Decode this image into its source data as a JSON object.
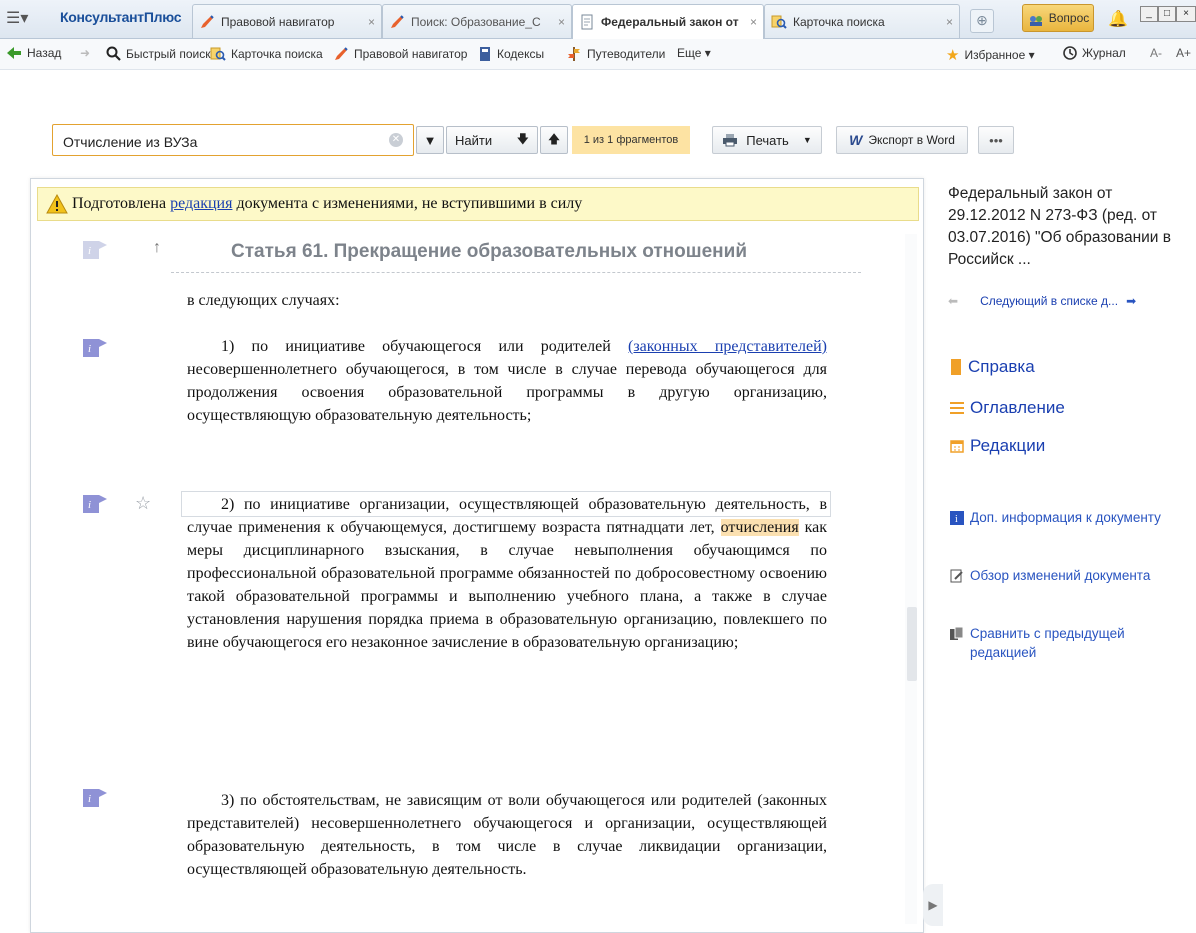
{
  "app": {
    "brand": "КонсультантПлюс"
  },
  "tabs": [
    {
      "label": "Правовой навигатор",
      "close": "×"
    },
    {
      "label": "Поиск: Образование_С",
      "close": "×"
    },
    {
      "label": "Федеральный закон от",
      "close": "×"
    },
    {
      "label": "Карточка поиска",
      "close": "×"
    }
  ],
  "header": {
    "question_label": "Вопрос",
    "window_controls": [
      "_",
      "□",
      "×"
    ]
  },
  "nav": {
    "back": "Назад",
    "quick_search": "Быстрый поиск",
    "search_card": "Карточка поиска",
    "legal_navigator": "Правовой навигатор",
    "codes": "Кодексы",
    "guides": "Путеводители",
    "more": "Еще ▾",
    "favorites": "Избранное ▾",
    "journal": "Журнал",
    "font_minus": "A-",
    "font_plus": "A+"
  },
  "toolbar": {
    "search_value": "Отчисление из ВУЗа",
    "find_label": "Найти",
    "fragments": "1 из 1 фрагментов",
    "print_label": "Печать",
    "export_label": "Экспорт в Word",
    "more_label": "•••"
  },
  "document": {
    "notice_pre": "Подготовлена ",
    "notice_link": "редакция",
    "notice_post": " документа с изменениями, не вступившими в силу",
    "article_title": "Статья 61. Прекращение образовательных отношений",
    "intro": "в следующих случаях:",
    "p1_pre": "1) по инициативе обучающегося или родителей ",
    "p1_link": "(законных представителей)",
    "p1_post": " несовершеннолетнего обучающегося, в том числе в случае перевода обучающегося для продолжения освоения образовательной программы в другую организацию, осуществляющую образовательную деятельность;",
    "p2_pre": "2) по инициативе организации, осуществляющей образовательную деятельность, в случае применения к обучающемуся, достигшему возраста пятнадцати лет, ",
    "p2_hl": "отчисления",
    "p2_post": " как меры дисциплинарного взыскания, в случае невыполнения обучающимся по профессиональной образовательной программе обязанностей по добросовестному освоению такой образовательной программы и выполнению учебного плана, а также в случае установления нарушения порядка приема в образовательную организацию, повлекшего по вине обучающегося его незаконное зачисление в образовательную организацию;",
    "p3": "3) по обстоятельствам, не зависящим от воли обучающегося или родителей (законных представителей) несовершеннолетнего обучающегося и организации, осуществляющей образовательную деятельность, в том числе в случае ликвидации организации, осуществляющей образовательную деятельность."
  },
  "right_panel": {
    "doc_title": "Федеральный закон от 29.12.2012 N 273-ФЗ (ред. от 03.07.2016) \"Об образовании в Российск ...",
    "next_in_list": "Следующий в списке д...",
    "reference": "Справка",
    "contents": "Оглавление",
    "editions": "Редакции",
    "extra_info": "Доп. информация к документу",
    "changes_review": "Обзор изменений документа",
    "compare_prev": "Сравнить с предыдущей редакцией"
  },
  "colors": {
    "accent_orange": "#e3a230",
    "link_blue": "#1a3fb0",
    "highlight": "#fbe0b0",
    "notice_bg": "#fdf9c8"
  },
  "icons": [
    "menu-icon",
    "pen-icon",
    "document-icon",
    "magnifier-card-icon",
    "plus-icon",
    "bell-icon",
    "back-arrow-icon",
    "search-icon",
    "book-icon",
    "guide-icon",
    "star-icon",
    "clock-icon",
    "clear-icon",
    "down-arrow-icon",
    "up-arrow-icon",
    "printer-icon",
    "word-icon",
    "warning-icon",
    "info-flag-icon",
    "bookmark-icon",
    "list-icon",
    "calendar-icon",
    "compare-icon"
  ]
}
